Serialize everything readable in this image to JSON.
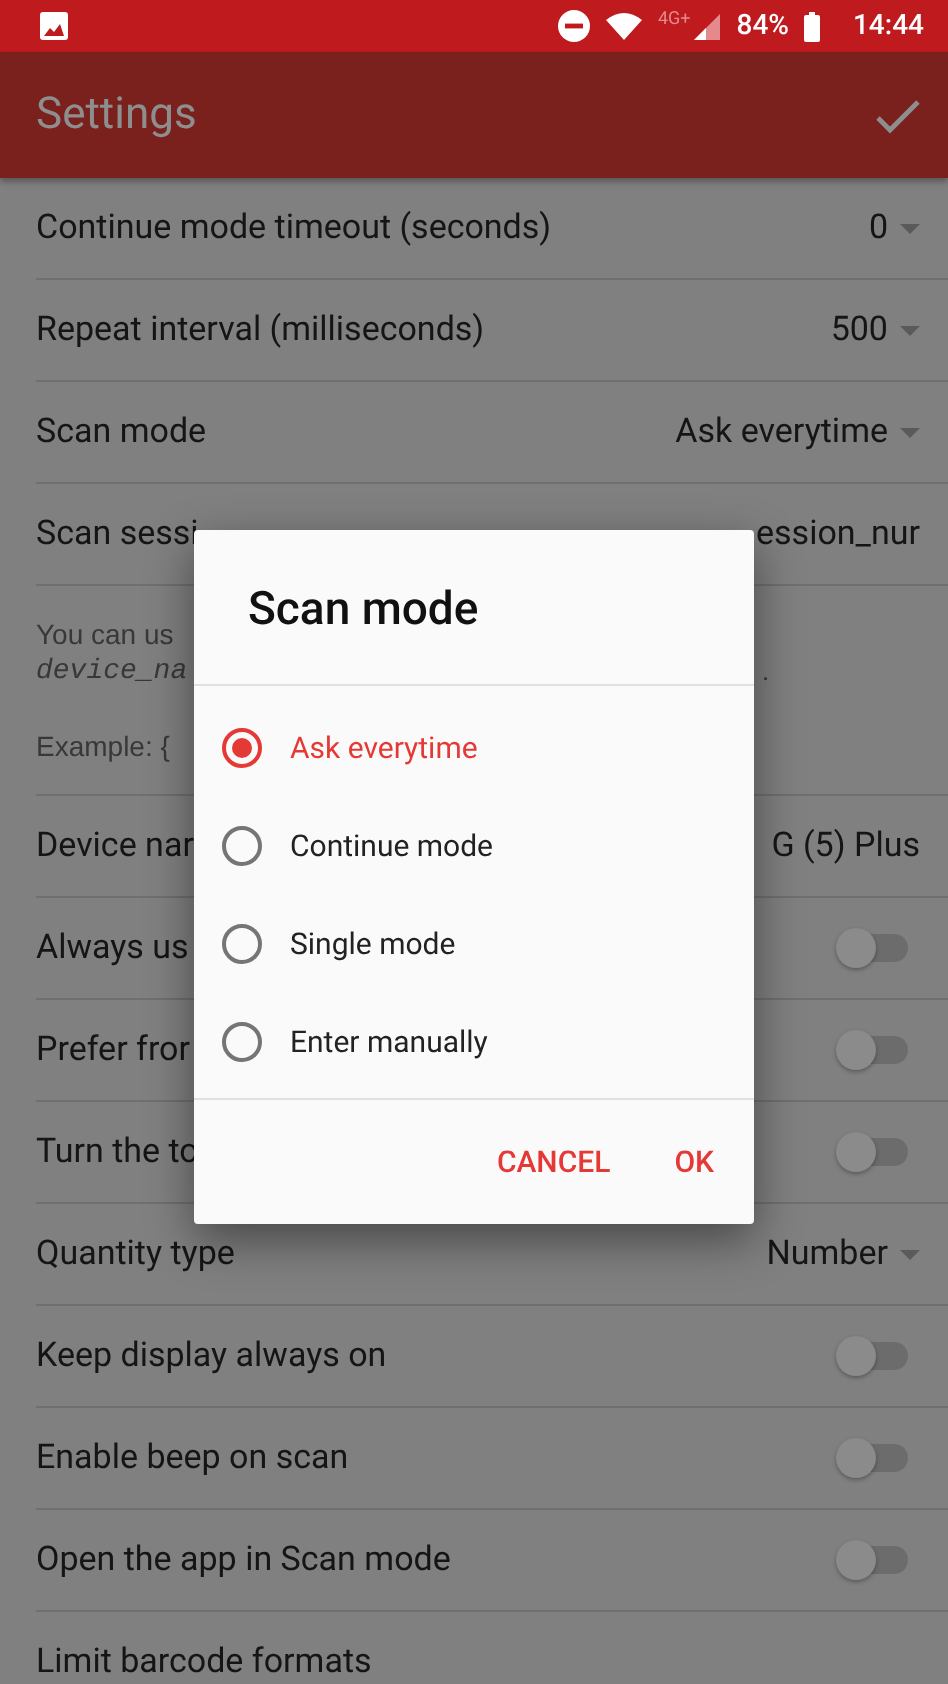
{
  "status_bar": {
    "network": "4G+",
    "battery": "84%",
    "time": "14:44"
  },
  "app_bar": {
    "title": "Settings"
  },
  "settings": [
    {
      "kind": "dropdown",
      "label": "Continue mode timeout (seconds)",
      "value": "0"
    },
    {
      "kind": "dropdown",
      "label": "Repeat interval (milliseconds)",
      "value": "500"
    },
    {
      "kind": "dropdown",
      "label": "Scan mode",
      "value": "Ask everytime"
    },
    {
      "kind": "text",
      "label": "Scan sessi",
      "value": "ession_nur"
    },
    {
      "kind": "help",
      "lines": [
        {
          "text": "You can us",
          "mono": false
        },
        {
          "text": "device_na",
          "mono": true
        },
        {
          "text": "Example: {",
          "mono": false
        }
      ],
      "tail": "."
    },
    {
      "kind": "text",
      "label": "Device nar",
      "value": "G (5) Plus"
    },
    {
      "kind": "switch",
      "label": "Always us",
      "on": false
    },
    {
      "kind": "switch",
      "label": "Prefer fror",
      "on": false
    },
    {
      "kind": "switch",
      "label": "Turn the to",
      "on": false
    },
    {
      "kind": "dropdown",
      "label": "Quantity type",
      "value": "Number"
    },
    {
      "kind": "switch",
      "label": "Keep display always on",
      "on": false
    },
    {
      "kind": "switch",
      "label": "Enable beep on scan",
      "on": false
    },
    {
      "kind": "switch",
      "label": "Open the app in Scan mode",
      "on": false
    },
    {
      "kind": "plain",
      "label": "Limit barcode formats"
    }
  ],
  "dialog": {
    "title": "Scan mode",
    "options": [
      {
        "label": "Ask everytime",
        "selected": true
      },
      {
        "label": "Continue mode",
        "selected": false
      },
      {
        "label": "Single mode",
        "selected": false
      },
      {
        "label": "Enter manually",
        "selected": false
      }
    ],
    "buttons": [
      "CANCEL",
      "OK"
    ]
  }
}
